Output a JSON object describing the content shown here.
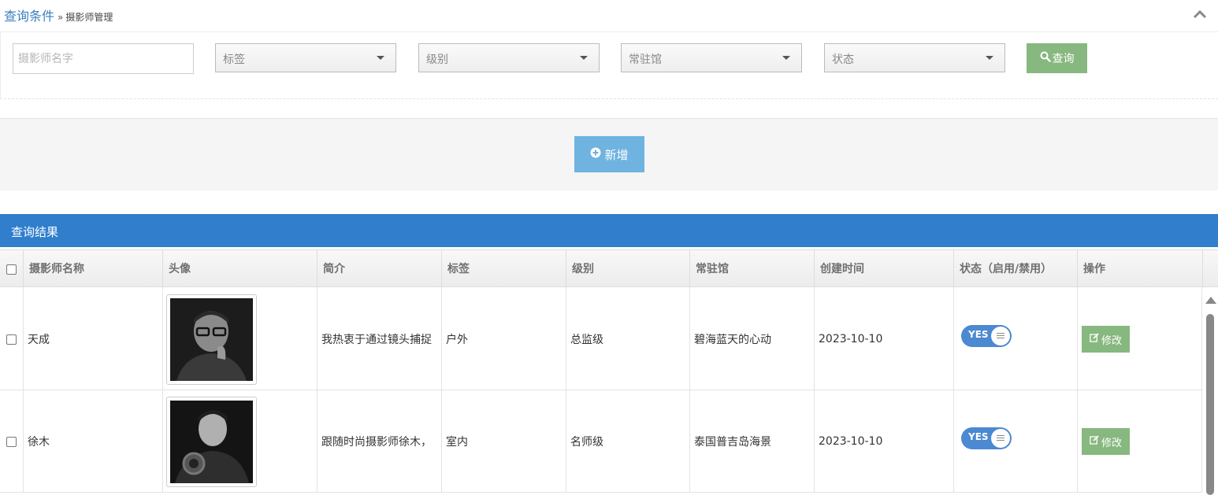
{
  "header": {
    "title": "查询条件",
    "separator": "»",
    "page": "摄影师管理"
  },
  "filters": {
    "name_placeholder": "摄影师名字",
    "tag": "标签",
    "level": "级别",
    "venue": "常驻馆",
    "status": "状态",
    "query_label": "查询"
  },
  "actions": {
    "add_label": "新增"
  },
  "results": {
    "title": "查询结果",
    "columns": {
      "name": "摄影师名称",
      "avatar": "头像",
      "intro": "简介",
      "tag": "标签",
      "level": "级别",
      "venue": "常驻馆",
      "created": "创建时间",
      "status": "状态（启用/禁用）",
      "ops": "操作"
    },
    "rows": [
      {
        "name": "天成",
        "intro": "我热衷于通过镜头捕捉",
        "tag": "户外",
        "level": "总监级",
        "venue": "碧海蓝天的心动",
        "created": "2023-10-10",
        "status": "YES",
        "edit": "修改"
      },
      {
        "name": "徐木",
        "intro": "跟随时尚摄影师徐木，",
        "tag": "室内",
        "level": "名师级",
        "venue": "泰国普吉岛海景",
        "created": "2023-10-10",
        "status": "YES",
        "edit": "修改"
      }
    ]
  },
  "colors": {
    "accent_blue": "#307ecc",
    "green_button": "#87b87f",
    "add_button": "#6fb3e0",
    "toggle": "#4b89d1"
  },
  "icons": [
    "chevron-up-icon",
    "search-icon",
    "plus-circle-icon",
    "edit-icon"
  ]
}
